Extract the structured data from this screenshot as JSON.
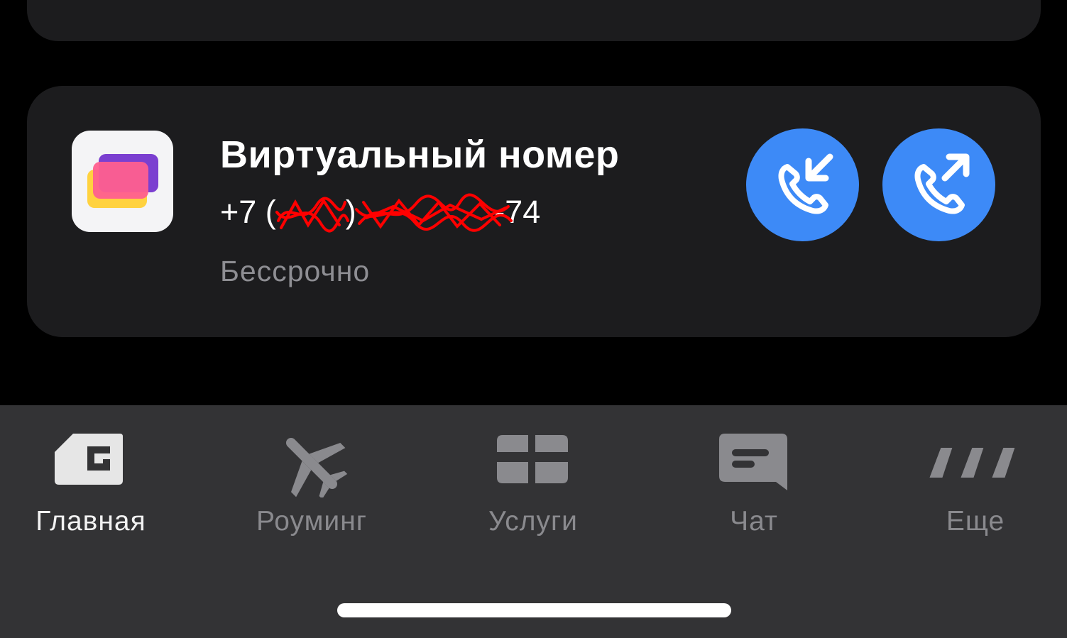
{
  "card": {
    "title": "Виртуальный номер",
    "phone_prefix": "+7 (",
    "phone_middle": ") ",
    "phone_suffix": "-74",
    "validity": "Бессрочно",
    "redaction_color": "#ff0000"
  },
  "actions": {
    "incoming_icon": "incoming-call-icon",
    "outgoing_icon": "outgoing-call-icon",
    "accent_color": "#3d8af7"
  },
  "tabbar": {
    "items": [
      {
        "label": "Главная",
        "icon": "home-sim-icon",
        "active": true
      },
      {
        "label": "Роуминг",
        "icon": "airplane-icon",
        "active": false
      },
      {
        "label": "Услуги",
        "icon": "grid-icon",
        "active": false
      },
      {
        "label": "Чат",
        "icon": "chat-bubble-icon",
        "active": false
      },
      {
        "label": "Еще",
        "icon": "more-dots-icon",
        "active": false
      }
    ]
  }
}
